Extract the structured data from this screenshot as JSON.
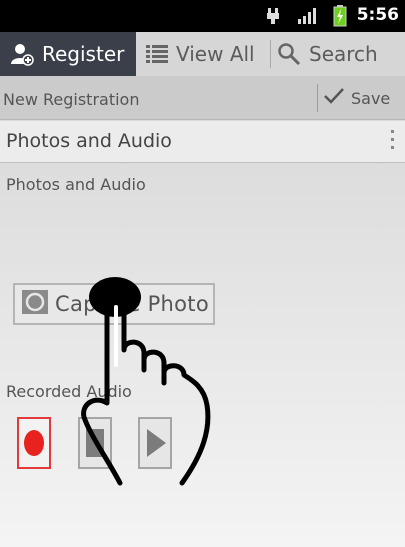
{
  "status_bar": {
    "time": "5:56",
    "icons": [
      "usb-icon",
      "signal-icon",
      "battery-charging-icon"
    ]
  },
  "tabs": [
    {
      "label": "Register",
      "icon": "person-add-icon",
      "active": true
    },
    {
      "label": "View All",
      "icon": "list-icon",
      "active": false
    },
    {
      "label": "Search",
      "icon": "search-icon",
      "active": false
    }
  ],
  "action_bar": {
    "title": "New Registration",
    "save_label": "Save",
    "save_icon": "checkmark-icon"
  },
  "section": {
    "title": "Photos and Audio",
    "menu_icon": "overflow-menu-icon"
  },
  "photo": {
    "subtitle": "Photos and Audio",
    "capture_label": "Capture Photo",
    "capture_icon": "camera-icon"
  },
  "audio": {
    "label": "Recorded Audio",
    "controls": [
      "record-icon",
      "stop-icon",
      "play-icon"
    ]
  },
  "colors": {
    "active_tab_bg": "#3a3f4a",
    "record_red": "#e23a3a",
    "status_bar_bg": "#000000",
    "battery_green": "#6fcf1f"
  },
  "overlay": {
    "gesture": "tap-gesture-hand-icon"
  }
}
